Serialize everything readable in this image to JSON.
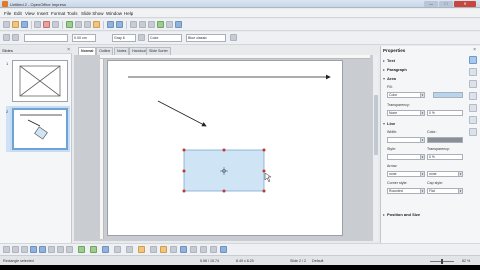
{
  "window": {
    "title": "Untitled 2 - OpenOffice Impress",
    "min_label": "—",
    "max_label": "□",
    "close_label": "✕"
  },
  "menu": [
    "File",
    "Edit",
    "View",
    "Insert",
    "Format",
    "Tools",
    "Slide Show",
    "Window",
    "Help"
  ],
  "toolbar": {
    "line_width": "0.00 cm",
    "line_color": "Gray 6",
    "area_style": "Color",
    "area_color": "Blue classic"
  },
  "slides_pane": {
    "title": "Slides",
    "close": "×",
    "slide_numbers": [
      "1",
      "2"
    ]
  },
  "view_tabs": [
    "Normal",
    "Outline",
    "Notes",
    "Handout",
    "Slide Sorter"
  ],
  "properties": {
    "title": "Properties",
    "close": "×",
    "sections": {
      "text": "Text",
      "paragraph": "Paragraph",
      "area": "Area",
      "line": "Line",
      "position": "Position and Size"
    },
    "area": {
      "fill_label": "Fill:",
      "fill_value": "Color",
      "transparency_label": "Transparency:",
      "transparency_value": "None",
      "transparency_pct": "0 %"
    },
    "line": {
      "width_label": "Width:",
      "color_label": "Color:",
      "style_label": "Style:",
      "transparency_label": "Transparency:",
      "transparency_pct": "0 %",
      "arrow_label": "Arrow:",
      "arrow_start": "none",
      "arrow_end": "none",
      "corner_label": "Corner style:",
      "corner_value": "Rounded",
      "cap_label": "Cap style:",
      "cap_value": "Flat"
    }
  },
  "status": {
    "selection": "Rectangle selected",
    "position": "5.98 / 15.74",
    "size": "8.49 x 8.20",
    "slide": "Slide 2 / 2",
    "layout": "Default",
    "zoom": "82 %"
  },
  "colors": {
    "rect_fill": "#cfe4f5",
    "rect_stroke": "#4f81bd",
    "handle": "#c0392b",
    "selected_slide_highlight": "#6ea3d8"
  }
}
